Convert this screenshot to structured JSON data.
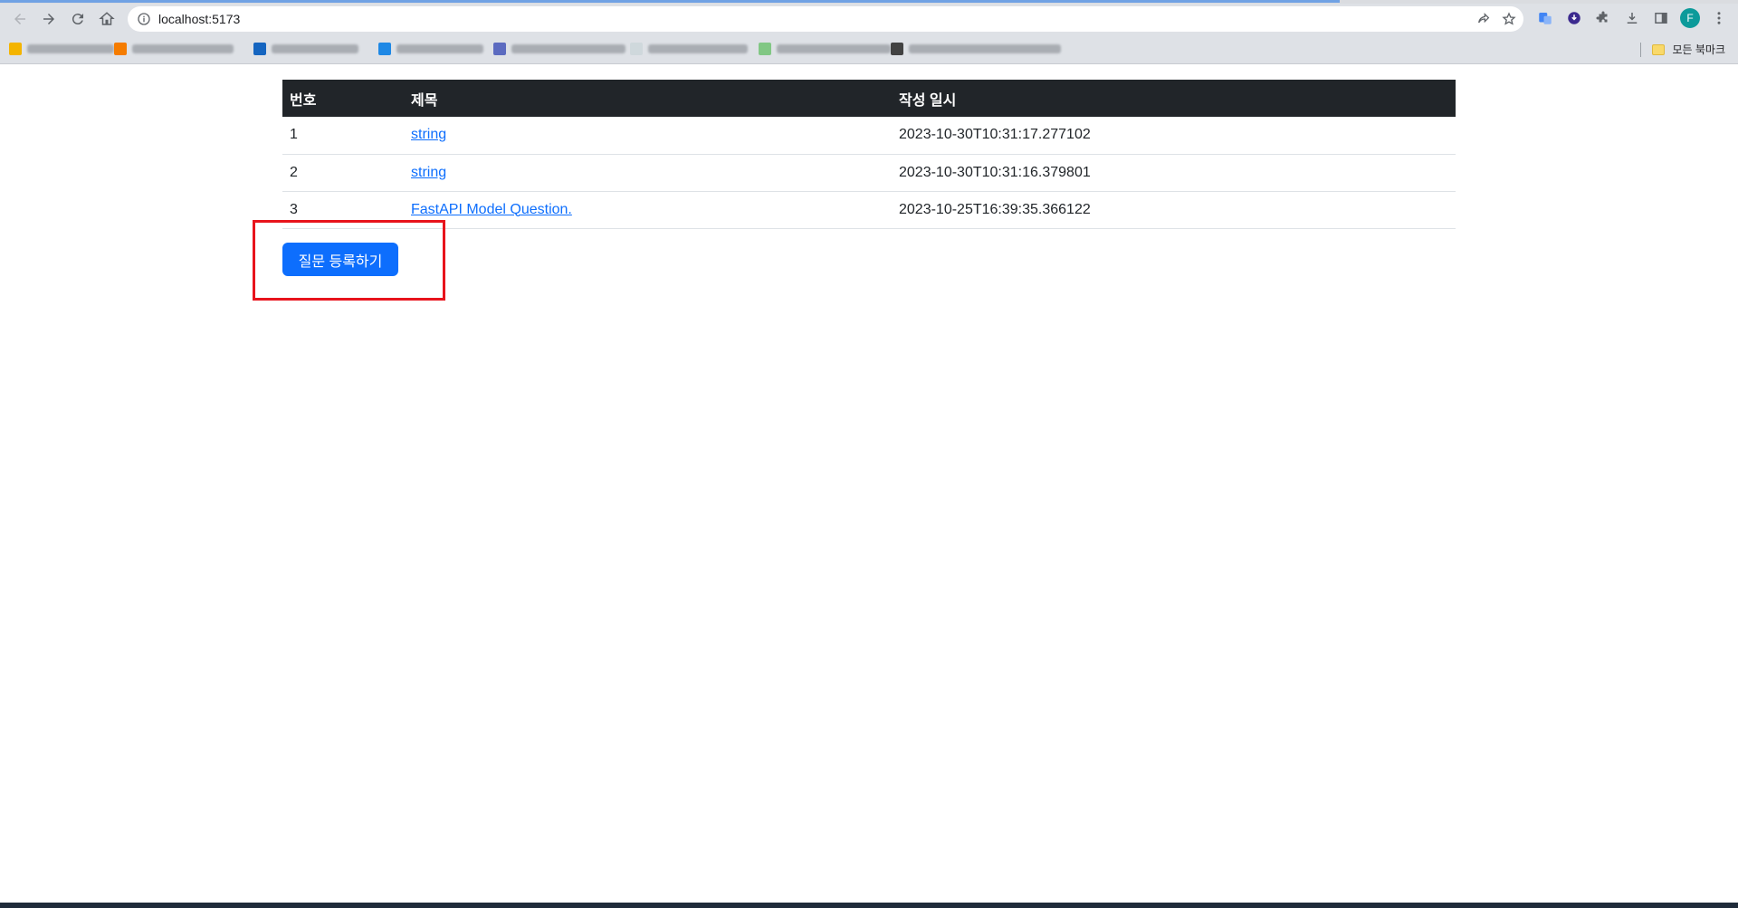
{
  "browser": {
    "url": "localhost:5173",
    "avatar_letter": "F",
    "all_bookmarks_label": "모든 북마크",
    "accent_color": "#1a73e8"
  },
  "bookmarks": [
    {
      "icon_color": "#f4b400"
    },
    {
      "icon_color": "#f57c00"
    },
    {
      "icon_color": "#1565c0"
    },
    {
      "icon_color": "#1e88e5"
    },
    {
      "icon_color": "#5c6bc0"
    },
    {
      "icon_color": "#cfd8dc"
    },
    {
      "icon_color": "#81c784"
    },
    {
      "icon_color": "#424242"
    }
  ],
  "table": {
    "headers": {
      "num": "번호",
      "title": "제목",
      "date": "작성 일시"
    },
    "rows": [
      {
        "num": "1",
        "title": "string",
        "date": "2023-10-30T10:31:17.277102"
      },
      {
        "num": "2",
        "title": "string",
        "date": "2023-10-30T10:31:16.379801"
      },
      {
        "num": "3",
        "title": "FastAPI Model Question.",
        "date": "2023-10-25T16:39:35.366122"
      }
    ]
  },
  "actions": {
    "create_question_label": "질문 등록하기",
    "primary_color": "#0d6efd",
    "highlight_color": "#e8141c"
  }
}
